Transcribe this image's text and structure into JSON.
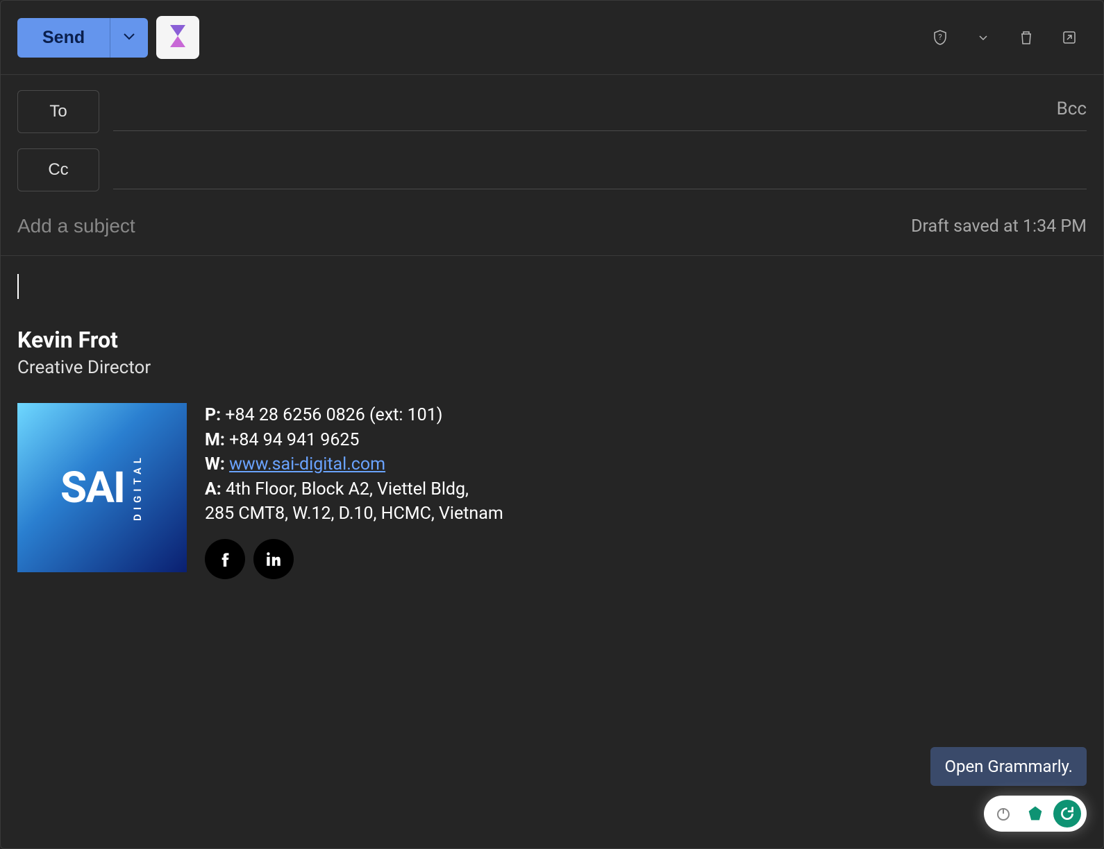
{
  "toolbar": {
    "send_label": "Send"
  },
  "recipients": {
    "to_label": "To",
    "cc_label": "Cc",
    "bcc_label": "Bcc",
    "to_value": "",
    "cc_value": ""
  },
  "subject": {
    "placeholder": "Add a subject",
    "value": "",
    "draft_status": "Draft saved at 1:34 PM"
  },
  "signature": {
    "name": "Kevin Frot",
    "title": "Creative Director",
    "logo_main": "SAI",
    "logo_sub": "DIGITAL",
    "phone_label": "P:",
    "phone": " +84 28 6256 0826 (ext: 101)",
    "mobile_label": "M:",
    "mobile": " +84 94 941 9625",
    "web_label": "W:",
    "web_url": "www.sai-digital.com",
    "address_label": "A:",
    "address_line1": " 4th Floor, Block A2, Viettel Bldg,",
    "address_line2": "285 CMT8, W.12, D.10, HCMC, Vietnam"
  },
  "grammarly": {
    "tooltip": "Open Grammarly."
  }
}
